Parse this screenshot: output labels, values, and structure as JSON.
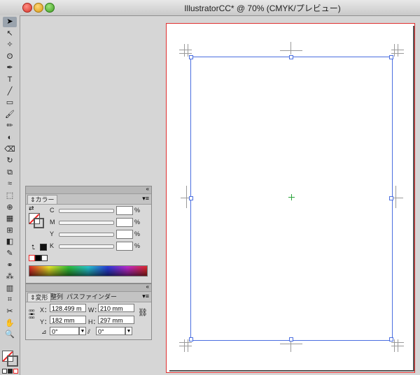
{
  "window": {
    "title": "IllustratorCC* @ 70% (CMYK/プレビュー)"
  },
  "tools": [
    {
      "name": "selection-tool-icon",
      "glyph": "➤"
    },
    {
      "name": "direct-selection-tool-icon",
      "glyph": "↖"
    },
    {
      "name": "magic-wand-tool-icon",
      "glyph": "✧"
    },
    {
      "name": "lasso-tool-icon",
      "glyph": "ʘ"
    },
    {
      "name": "pen-tool-icon",
      "glyph": "✒"
    },
    {
      "name": "type-tool-icon",
      "glyph": "T"
    },
    {
      "name": "line-tool-icon",
      "glyph": "╱"
    },
    {
      "name": "rectangle-tool-icon",
      "glyph": "▭"
    },
    {
      "name": "paintbrush-tool-icon",
      "glyph": "🖌"
    },
    {
      "name": "pencil-tool-icon",
      "glyph": "✏"
    },
    {
      "name": "blob-brush-tool-icon",
      "glyph": "◐"
    },
    {
      "name": "eraser-tool-icon",
      "glyph": "⌫"
    },
    {
      "name": "rotate-tool-icon",
      "glyph": "↻"
    },
    {
      "name": "scale-tool-icon",
      "glyph": "⧉"
    },
    {
      "name": "warp-tool-icon",
      "glyph": "≈"
    },
    {
      "name": "free-transform-tool-icon",
      "glyph": "⬚"
    },
    {
      "name": "shape-builder-tool-icon",
      "glyph": "⊕"
    },
    {
      "name": "perspective-grid-tool-icon",
      "glyph": "▦"
    },
    {
      "name": "mesh-tool-icon",
      "glyph": "⊞"
    },
    {
      "name": "gradient-tool-icon",
      "glyph": "◧"
    },
    {
      "name": "eyedropper-tool-icon",
      "glyph": "✎"
    },
    {
      "name": "blend-tool-icon",
      "glyph": "⚭"
    },
    {
      "name": "symbol-sprayer-tool-icon",
      "glyph": "⁂"
    },
    {
      "name": "column-graph-tool-icon",
      "glyph": "▥"
    },
    {
      "name": "artboard-tool-icon",
      "glyph": "⌗"
    },
    {
      "name": "slice-tool-icon",
      "glyph": "✂"
    },
    {
      "name": "hand-tool-icon",
      "glyph": "✋"
    },
    {
      "name": "zoom-tool-icon",
      "glyph": "🔍"
    }
  ],
  "color_panel": {
    "tab_label": "カラー",
    "channels": [
      {
        "label": "C",
        "value": ""
      },
      {
        "label": "M",
        "value": ""
      },
      {
        "label": "Y",
        "value": ""
      },
      {
        "label": "K",
        "value": ""
      }
    ],
    "percent_sign": "%"
  },
  "transform_panel": {
    "tabs": [
      "変形",
      "整列",
      "パスファインダー"
    ],
    "x_label": "X：",
    "x_value": "128.499 m",
    "y_label": "Y：",
    "y_value": "182 mm",
    "w_label": "W：",
    "w_value": "210 mm",
    "h_label": "H：",
    "h_value": "297 mm",
    "rotate_value": "0°",
    "shear_value": "0°"
  }
}
